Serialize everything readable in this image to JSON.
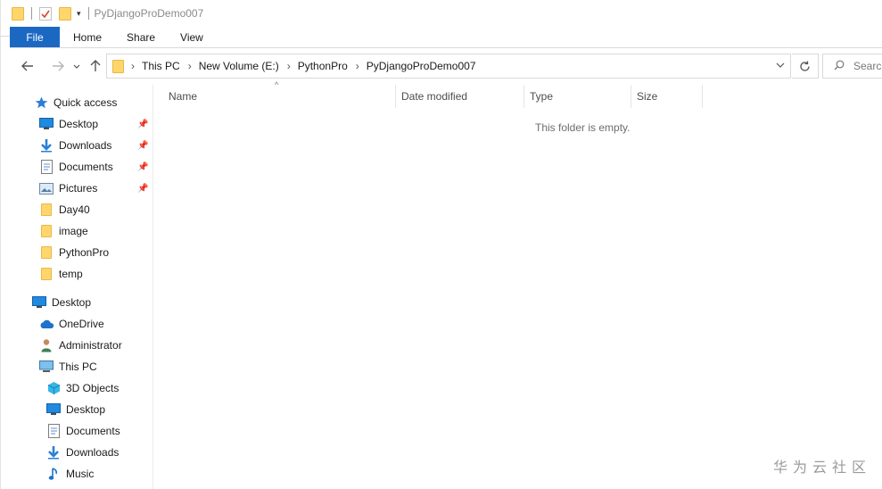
{
  "window": {
    "title": "PyDjangoProDemo007"
  },
  "ribbon": {
    "tabs": [
      "File",
      "Home",
      "Share",
      "View"
    ]
  },
  "address": {
    "crumbs": [
      "This PC",
      "New Volume (E:)",
      "PythonPro",
      "PyDjangoProDemo007"
    ],
    "search_placeholder": "Search"
  },
  "navpane": {
    "quick_access": "Quick access",
    "quick_items": [
      {
        "label": "Desktop",
        "icon": "desktop-icon",
        "pinned": true
      },
      {
        "label": "Downloads",
        "icon": "download-icon",
        "pinned": true
      },
      {
        "label": "Documents",
        "icon": "document-icon",
        "pinned": true
      },
      {
        "label": "Pictures",
        "icon": "pictures-icon",
        "pinned": true
      },
      {
        "label": "Day40",
        "icon": "folder-icon",
        "pinned": false
      },
      {
        "label": "image",
        "icon": "folder-icon",
        "pinned": false
      },
      {
        "label": "PythonPro",
        "icon": "folder-icon",
        "pinned": false
      },
      {
        "label": "temp",
        "icon": "folder-icon",
        "pinned": false
      }
    ],
    "desktop": "Desktop",
    "desktop_children": [
      "OneDrive",
      "Administrator",
      "This PC"
    ],
    "thispc_children": [
      "3D Objects",
      "Desktop",
      "Documents",
      "Downloads",
      "Music"
    ]
  },
  "columns": {
    "name": "Name",
    "date_modified": "Date modified",
    "type": "Type",
    "size": "Size"
  },
  "content": {
    "empty_text": "This folder is empty."
  },
  "watermark": "华为云社区",
  "colors": {
    "file_tab": "#1b68c3",
    "folder": "#ffd66b"
  }
}
